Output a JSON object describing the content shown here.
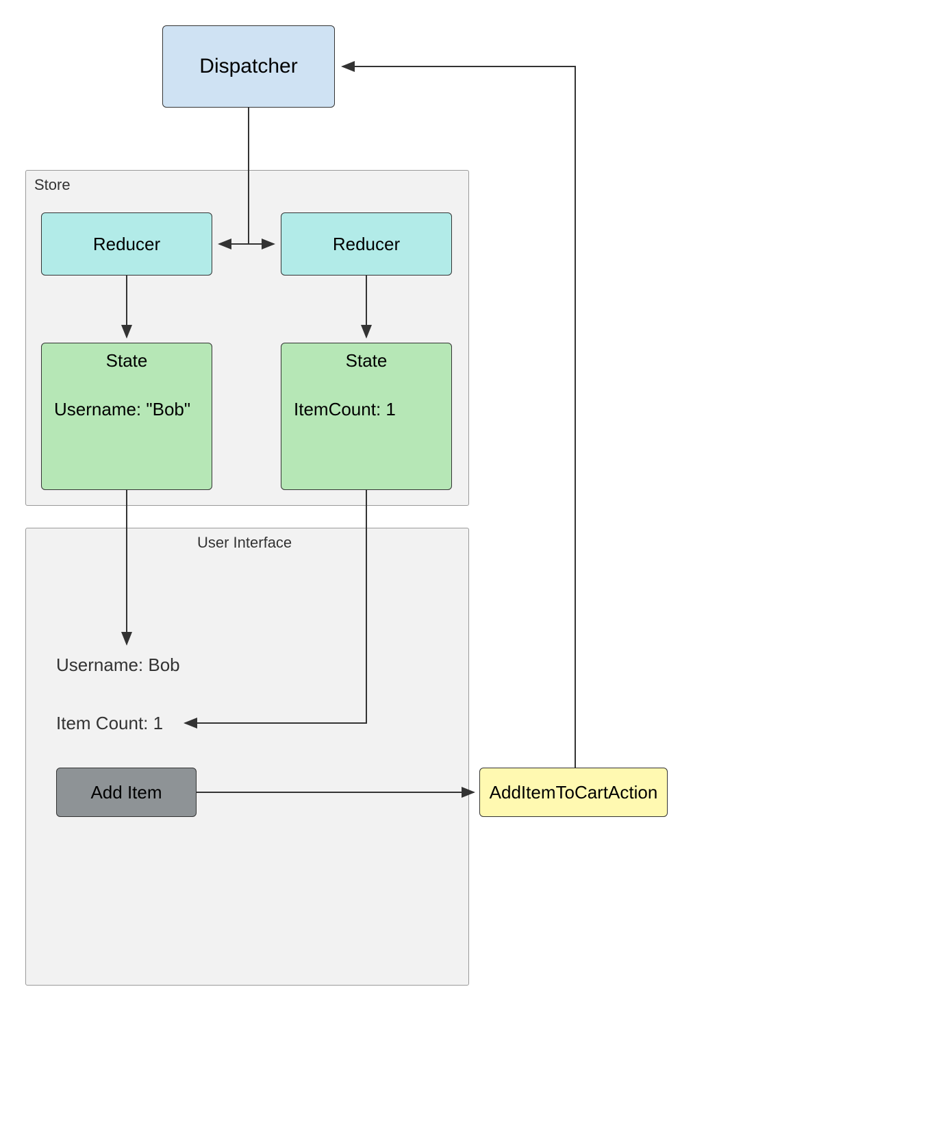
{
  "nodes": {
    "dispatcher": {
      "label": "Dispatcher"
    },
    "store": {
      "label": "Store"
    },
    "reducer1": {
      "label": "Reducer"
    },
    "reducer2": {
      "label": "Reducer"
    },
    "state1": {
      "title": "State",
      "content": "Username: \"Bob\""
    },
    "state2": {
      "title": "State",
      "content": "ItemCount: 1"
    },
    "ui": {
      "label": "User Interface"
    },
    "ui_username": "Username: Bob",
    "ui_itemcount": "Item Count: 1",
    "add_button": {
      "label": "Add Item"
    },
    "action": {
      "label": "AddItemToCartAction"
    }
  },
  "edges": [
    {
      "from": "dispatcher",
      "to": "reducer1"
    },
    {
      "from": "dispatcher",
      "to": "reducer2"
    },
    {
      "from": "reducer1",
      "to": "state1"
    },
    {
      "from": "reducer2",
      "to": "state2"
    },
    {
      "from": "state1",
      "to": "ui_username"
    },
    {
      "from": "state2",
      "to": "ui_itemcount"
    },
    {
      "from": "add_button",
      "to": "action"
    },
    {
      "from": "action",
      "to": "dispatcher"
    }
  ]
}
